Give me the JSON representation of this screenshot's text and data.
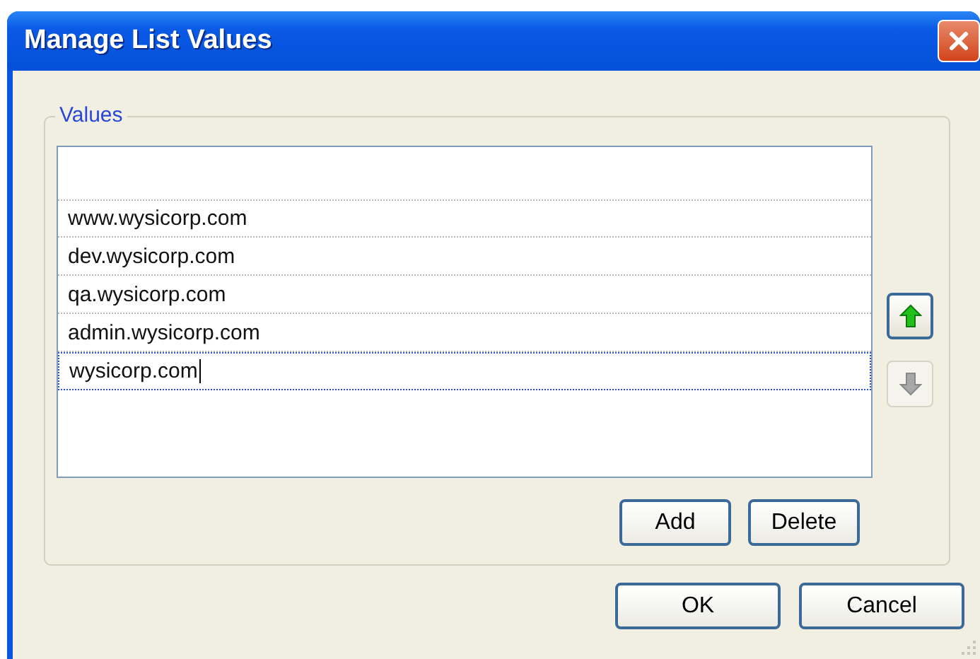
{
  "window": {
    "title": "Manage List Values"
  },
  "group": {
    "label": "Values"
  },
  "values": [
    {
      "text": "www.wysicorp.com",
      "editing": false
    },
    {
      "text": "dev.wysicorp.com",
      "editing": false
    },
    {
      "text": "qa.wysicorp.com",
      "editing": false
    },
    {
      "text": "admin.wysicorp.com",
      "editing": false
    },
    {
      "text": "wysicorp.com",
      "editing": true
    }
  ],
  "move_buttons": [
    {
      "kind": "up",
      "disabled": false
    },
    {
      "kind": "down",
      "disabled": true
    }
  ],
  "list_buttons": [
    "Add",
    "Delete"
  ],
  "dialog_buttons": [
    "OK",
    "Cancel"
  ]
}
